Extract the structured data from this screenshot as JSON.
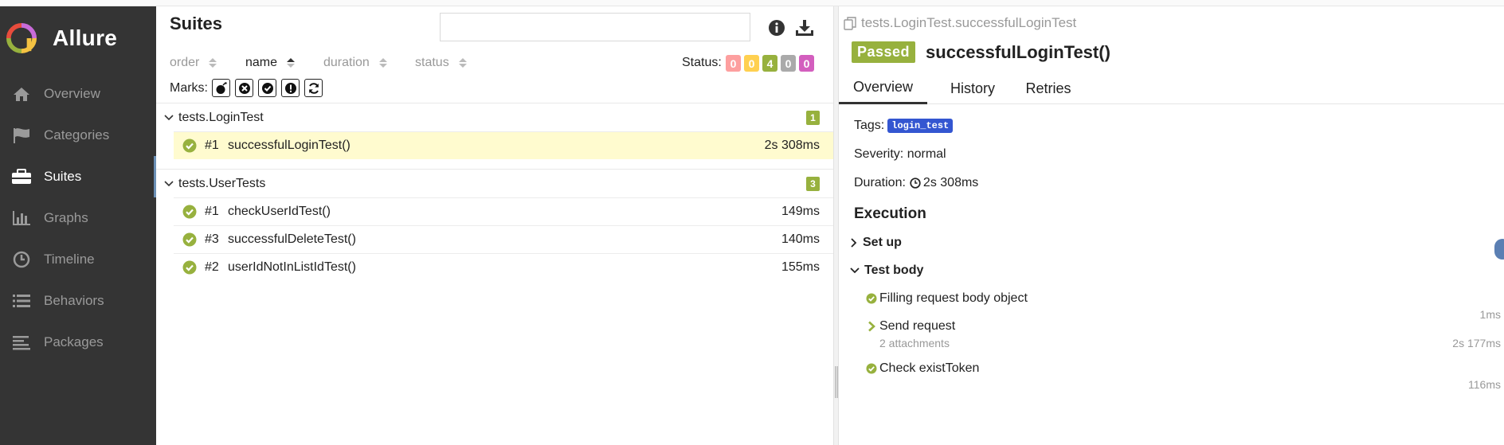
{
  "app": {
    "name": "Allure"
  },
  "sidebar": {
    "items": [
      {
        "label": "Overview",
        "icon": "home-icon",
        "active": false
      },
      {
        "label": "Categories",
        "icon": "flag-icon",
        "active": false
      },
      {
        "label": "Suites",
        "icon": "briefcase-icon",
        "active": true
      },
      {
        "label": "Graphs",
        "icon": "bar-chart-icon",
        "active": false
      },
      {
        "label": "Timeline",
        "icon": "clock-icon",
        "active": false
      },
      {
        "label": "Behaviors",
        "icon": "list-icon",
        "active": false
      },
      {
        "label": "Packages",
        "icon": "align-left-icon",
        "active": false
      }
    ]
  },
  "suites": {
    "title": "Suites",
    "search": {
      "value": "",
      "placeholder": ""
    },
    "sort": {
      "order": "order",
      "name": "name",
      "duration": "duration",
      "status": "status"
    },
    "status_label": "Status:",
    "status_counts": [
      {
        "status": "failed",
        "count": "0",
        "color": "#fd9f9f"
      },
      {
        "status": "broken",
        "count": "0",
        "color": "#ffd050"
      },
      {
        "status": "passed",
        "count": "4",
        "color": "#97b13e"
      },
      {
        "status": "skipped",
        "count": "0",
        "color": "#aaaaaa"
      },
      {
        "status": "unknown",
        "count": "0",
        "color": "#d35ebe"
      }
    ],
    "marks_label": "Marks:",
    "groups": [
      {
        "name": "tests.LoginTest",
        "count": "1",
        "rows": [
          {
            "num": "#1",
            "name": "successfulLoginTest()",
            "duration": "2s 308ms",
            "selected": true
          }
        ]
      },
      {
        "name": "tests.UserTests",
        "count": "3",
        "rows": [
          {
            "num": "#1",
            "name": "checkUserIdTest()",
            "duration": "149ms",
            "selected": false
          },
          {
            "num": "#3",
            "name": "successfulDeleteTest()",
            "duration": "140ms",
            "selected": false
          },
          {
            "num": "#2",
            "name": "userIdNotInListIdTest()",
            "duration": "155ms",
            "selected": false
          }
        ]
      }
    ]
  },
  "details": {
    "breadcrumb": "tests.LoginTest.successfulLoginTest",
    "status": "Passed",
    "title": "successfulLoginTest()",
    "tabs": [
      "Overview",
      "History",
      "Retries"
    ],
    "tags_label": "Tags:",
    "tag": "login_test",
    "severity": "Severity: normal",
    "duration_label": "Duration:",
    "duration": "2s 308ms",
    "execution_title": "Execution",
    "setup_label": "Set up",
    "body_label": "Test body",
    "steps": [
      {
        "name": "Filling request body object",
        "time": "1ms",
        "sub": ""
      },
      {
        "name": "Send request",
        "time": "2s 177ms",
        "sub": "2 attachments"
      },
      {
        "name": "Check existToken",
        "time": "116ms",
        "sub": ""
      }
    ]
  },
  "colors": {
    "sidebar_bg": "#343434",
    "passed": "#97b13e",
    "selected_row": "#fffbcf",
    "tag_bg": "#3456d1"
  }
}
